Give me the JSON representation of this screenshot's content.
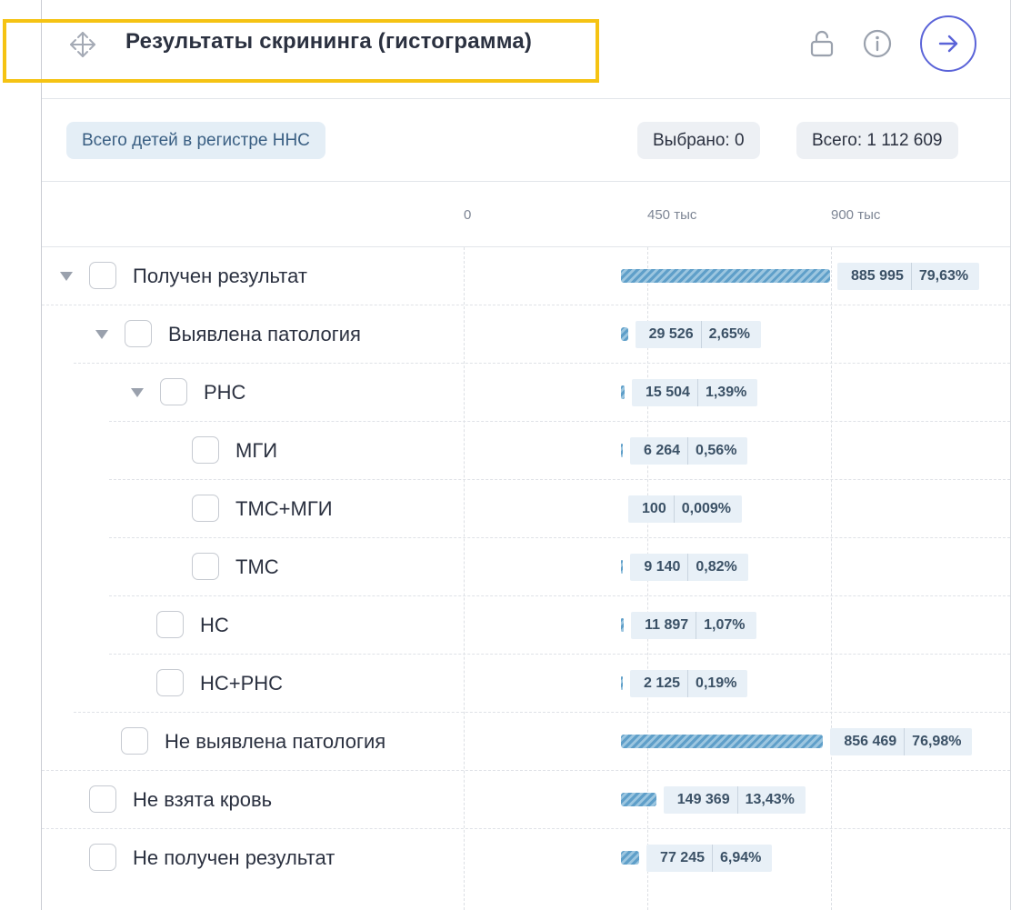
{
  "header": {
    "title": "Результаты скрининга (гистограмма)",
    "icons": {
      "move": "move-icon",
      "lock": "unlock-icon",
      "info": "info-icon",
      "go": "arrow-right-icon"
    },
    "accent_color": "#5a63d8",
    "highlight_color": "#f5c313"
  },
  "toolbar": {
    "filter_label": "Всего детей в регистре ННС",
    "selected_label": "Выбрано: 0",
    "total_label": "Всего: 1 112 609"
  },
  "axis": {
    "ticks": [
      "0",
      "450 тыс",
      "900 тыс"
    ],
    "tick_values": [
      0,
      450000,
      900000
    ]
  },
  "bar_color": "#5f9fc9",
  "rows": [
    {
      "label": "Получен результат",
      "count": "885 995",
      "percent": "79,63%",
      "value": 885995,
      "level": 0,
      "expanded": true,
      "checked": false
    },
    {
      "label": "Выявлена патология",
      "count": "29 526",
      "percent": "2,65%",
      "value": 29526,
      "level": 1,
      "expanded": true,
      "checked": false
    },
    {
      "label": "РНС",
      "count": "15 504",
      "percent": "1,39%",
      "value": 15504,
      "level": 2,
      "expanded": true,
      "checked": false
    },
    {
      "label": "МГИ",
      "count": "6 264",
      "percent": "0,56%",
      "value": 6264,
      "level": 3,
      "checked": false
    },
    {
      "label": "ТМС+МГИ",
      "count": "100",
      "percent": "0,009%",
      "value": 100,
      "level": 3,
      "checked": false
    },
    {
      "label": "ТМС",
      "count": "9 140",
      "percent": "0,82%",
      "value": 9140,
      "level": 3,
      "checked": false
    },
    {
      "label": "НС",
      "count": "11 897",
      "percent": "1,07%",
      "value": 11897,
      "level": 2,
      "checked": false
    },
    {
      "label": "НС+РНС",
      "count": "2 125",
      "percent": "0,19%",
      "value": 2125,
      "level": 2,
      "checked": false
    },
    {
      "label": "Не выявлена патология",
      "count": "856 469",
      "percent": "76,98%",
      "value": 856469,
      "level": 1,
      "checked": false
    },
    {
      "label": "Не взята кровь",
      "count": "149 369",
      "percent": "13,43%",
      "value": 149369,
      "level": 0,
      "checked": false
    },
    {
      "label": "Не получен результат",
      "count": "77 245",
      "percent": "6,94%",
      "value": 77245,
      "level": 0,
      "checked": false
    }
  ]
}
